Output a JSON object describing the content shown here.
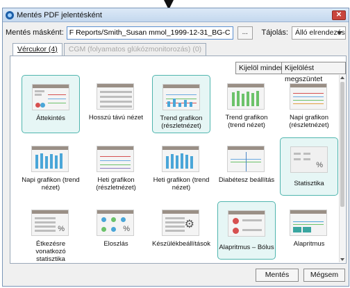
{
  "window": {
    "title": "Mentés PDF jelentésként"
  },
  "save_as": {
    "label": "Mentés másként:",
    "value": "F Reports/Smith_Susan mmol_1999-12-31_BG-CSII_2018-03-13",
    "browse_label": "..."
  },
  "orientation": {
    "label": "Tájolás:",
    "value": "Álló elrendezés"
  },
  "tabs": [
    {
      "label": "Vércukor (4)",
      "active": true
    },
    {
      "label": "CGM (folyamatos glükózmonitorozás) (0)",
      "active": false,
      "disabled": true
    }
  ],
  "actions": {
    "select_all": "Kijelöl mindent",
    "deselect_all": "Kijelölést megszüntet"
  },
  "reports": [
    {
      "label": "Áttekintés",
      "selected": true,
      "icon": "overview-icon"
    },
    {
      "label": "Hosszú távú nézet",
      "selected": false,
      "icon": "long-term-icon"
    },
    {
      "label": "Trend grafikon (részletnézet)",
      "selected": true,
      "icon": "trend-detail-icon"
    },
    {
      "label": "Trend grafikon (trend nézet)",
      "selected": false,
      "icon": "trend-view-icon"
    },
    {
      "label": "Napi grafikon (részletnézet)",
      "selected": false,
      "icon": "daily-detail-icon"
    },
    {
      "label": "Napi grafikon (trend nézet)",
      "selected": false,
      "icon": "daily-trend-icon"
    },
    {
      "label": "Heti grafikon (részletnézet)",
      "selected": false,
      "icon": "weekly-detail-icon"
    },
    {
      "label": "Heti grafikon (trend nézet)",
      "selected": false,
      "icon": "weekly-trend-icon"
    },
    {
      "label": "Diabétesz beállítás",
      "selected": false,
      "icon": "diabetes-settings-icon"
    },
    {
      "label": "Statisztika",
      "selected": true,
      "icon": "statistics-icon"
    },
    {
      "label": "Étkezésre vonatkozó statisztika",
      "selected": false,
      "icon": "meal-stats-icon"
    },
    {
      "label": "Eloszlás",
      "selected": false,
      "icon": "distribution-icon"
    },
    {
      "label": "Készülékbeállítások",
      "selected": false,
      "icon": "device-settings-icon"
    },
    {
      "label": "Alapritmus – Bólus",
      "selected": true,
      "icon": "basal-bolus-icon"
    },
    {
      "label": "Alapritmus",
      "selected": false,
      "icon": "basal-icon"
    }
  ],
  "footer": {
    "save": "Mentés",
    "cancel": "Mégsem"
  }
}
